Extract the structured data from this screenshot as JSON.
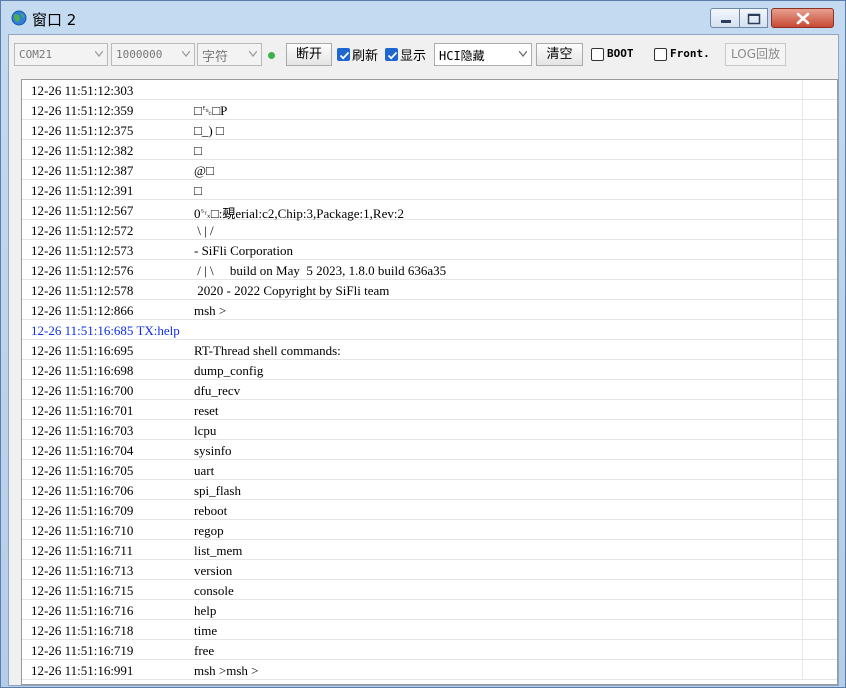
{
  "window": {
    "title": "窗口 2"
  },
  "toolbar": {
    "port": "COM21",
    "baud": "1000000",
    "encoding": "字符",
    "disconnect_label": "断开",
    "refresh_label": "刷新",
    "refresh_checked": true,
    "display_label": "显示",
    "display_checked": true,
    "hci_label": "HCI隐藏",
    "clear_label": "清空",
    "boot_label": "BOOT",
    "boot_checked": false,
    "front_label": "Front.",
    "front_checked": false,
    "log_replay_label": "LOG回放",
    "status_color": "#3bb34a"
  },
  "log": [
    {
      "ts": "12-26 11:51:12:303",
      "msg": ""
    },
    {
      "ts": "12-26 11:51:12:359",
      "msg": "□␛□P"
    },
    {
      "ts": "12-26 11:51:12:375",
      "msg": "□_) □"
    },
    {
      "ts": "12-26 11:51:12:382",
      "msg": "□"
    },
    {
      "ts": "12-26 11:51:12:387",
      "msg": "@□"
    },
    {
      "ts": "12-26 11:51:12:391",
      "msg": "□"
    },
    {
      "ts": "12-26 11:51:12:567",
      "msg": "0␂□:覡erial:c2,Chip:3,Package:1,Rev:2"
    },
    {
      "ts": "12-26 11:51:12:572",
      "msg": " \\ | /"
    },
    {
      "ts": "12-26 11:51:12:573",
      "msg": "- SiFli Corporation"
    },
    {
      "ts": "12-26 11:51:12:576",
      "msg": " / | \\     build on May  5 2023, 1.8.0 build 636a35"
    },
    {
      "ts": "12-26 11:51:12:578",
      "msg": " 2020 - 2022 Copyright by SiFli team"
    },
    {
      "ts": "12-26 11:51:12:866",
      "msg": "msh >"
    },
    {
      "ts": "12-26 11:51:16:685 TX:help",
      "msg": "",
      "tx": true
    },
    {
      "ts": "12-26 11:51:16:695",
      "msg": "RT-Thread shell commands:"
    },
    {
      "ts": "12-26 11:51:16:698",
      "msg": "dump_config"
    },
    {
      "ts": "12-26 11:51:16:700",
      "msg": "dfu_recv"
    },
    {
      "ts": "12-26 11:51:16:701",
      "msg": "reset"
    },
    {
      "ts": "12-26 11:51:16:703",
      "msg": "lcpu"
    },
    {
      "ts": "12-26 11:51:16:704",
      "msg": "sysinfo"
    },
    {
      "ts": "12-26 11:51:16:705",
      "msg": "uart"
    },
    {
      "ts": "12-26 11:51:16:706",
      "msg": "spi_flash"
    },
    {
      "ts": "12-26 11:51:16:709",
      "msg": "reboot"
    },
    {
      "ts": "12-26 11:51:16:710",
      "msg": "regop"
    },
    {
      "ts": "12-26 11:51:16:711",
      "msg": "list_mem"
    },
    {
      "ts": "12-26 11:51:16:713",
      "msg": "version"
    },
    {
      "ts": "12-26 11:51:16:715",
      "msg": "console"
    },
    {
      "ts": "12-26 11:51:16:716",
      "msg": "help"
    },
    {
      "ts": "12-26 11:51:16:718",
      "msg": "time"
    },
    {
      "ts": "12-26 11:51:16:719",
      "msg": "free"
    },
    {
      "ts": "12-26 11:51:16:991",
      "msg": "msh >msh >"
    }
  ]
}
